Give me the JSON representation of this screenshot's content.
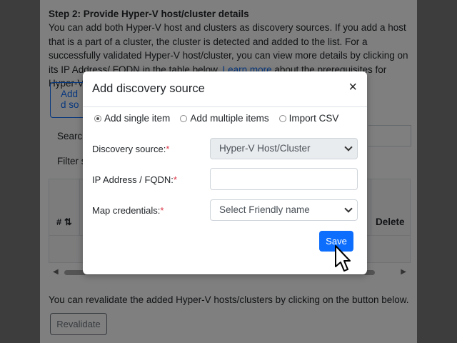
{
  "background": {
    "step_title": "Step 2: Provide Hyper-V host/cluster details",
    "step_desc_pre": "You can add both Hyper-V host and clusters as discovery sources. If you add a host that is a part of a cluster, the cluster is detected and added to the list. For a successfully validated Hyper-V host/cluster, you can view more details by clicking on its IP Address/ FQDN in the table below. ",
    "learn_more": "Learn more",
    "step_desc_post": " about the prerequisites for Hyper-V VMs discovery.",
    "add_button_partial": "Add d so",
    "search_label_partial": "Search",
    "filter_label_partial": "Filter s",
    "col_hash": "# ⇅",
    "col_delete": "Delete",
    "revalidate_text": "You can revalidate the added Hyper-V hosts/clusters by clicking on the button below.",
    "revalidate_button": "Revalidate"
  },
  "modal": {
    "title": "Add discovery source",
    "close": "×",
    "radio_options": [
      {
        "label": "Add single item",
        "checked": true
      },
      {
        "label": "Add multiple items",
        "checked": false
      },
      {
        "label": "Import CSV",
        "checked": false
      }
    ],
    "discovery_source_label": "Discovery source:",
    "discovery_source_value": "Hyper-V Host/Cluster",
    "ip_label": "IP Address / FQDN:",
    "ip_value": "",
    "credentials_label": "Map credentials:",
    "credentials_value": "Select Friendly name",
    "required_mark": "*",
    "save_label": "Save"
  },
  "colors": {
    "primary": "#0d6efd",
    "required": "#dc3545"
  }
}
